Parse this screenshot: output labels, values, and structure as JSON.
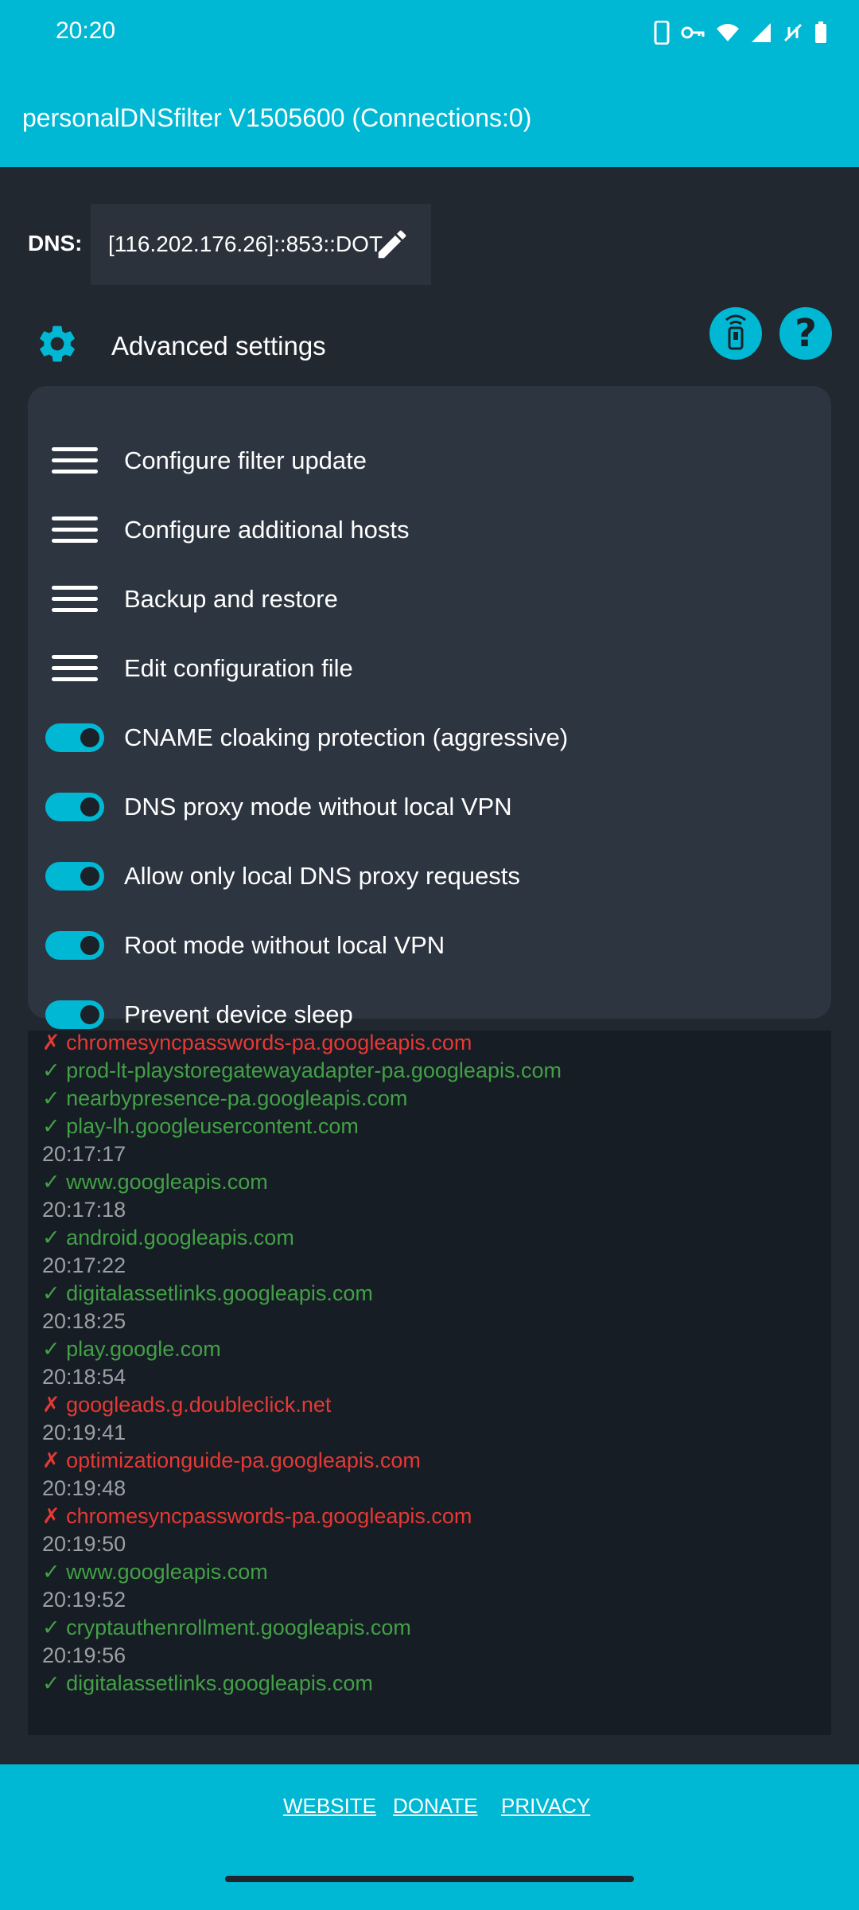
{
  "status_bar": {
    "time": "20:20"
  },
  "app": {
    "title": "personalDNSfilter V1505600 (Connections:0)"
  },
  "dns": {
    "label": "DNS:",
    "value": "[116.202.176.26]::853::DOT"
  },
  "advanced": {
    "label": "Advanced settings"
  },
  "menu_items": [
    {
      "label": "Configure filter update",
      "type": "menu"
    },
    {
      "label": "Configure additional hosts",
      "type": "menu"
    },
    {
      "label": "Backup and restore",
      "type": "menu"
    },
    {
      "label": "Edit configuration file",
      "type": "menu"
    },
    {
      "label": "CNAME cloaking protection (aggressive)",
      "type": "toggle",
      "on": true
    },
    {
      "label": "DNS proxy mode without local VPN",
      "type": "toggle",
      "on": true
    },
    {
      "label": "Allow only local DNS proxy requests",
      "type": "toggle",
      "on": true
    },
    {
      "label": "Root mode without local VPN",
      "type": "toggle",
      "on": true
    },
    {
      "label": "Prevent device sleep",
      "type": "toggle",
      "on": true
    }
  ],
  "log": [
    {
      "kind": "bad",
      "text": "✗ chromesyncpasswords-pa.googleapis.com"
    },
    {
      "kind": "ok",
      "text": "✓ prod-lt-playstoregatewayadapter-pa.googleapis.com"
    },
    {
      "kind": "ok",
      "text": "✓ nearbypresence-pa.googleapis.com"
    },
    {
      "kind": "ok",
      "text": "✓ play-lh.googleusercontent.com"
    },
    {
      "kind": "ts",
      "text": "20:17:17"
    },
    {
      "kind": "ok",
      "text": "✓ www.googleapis.com"
    },
    {
      "kind": "ts",
      "text": "20:17:18"
    },
    {
      "kind": "ok",
      "text": "✓ android.googleapis.com"
    },
    {
      "kind": "ts",
      "text": "20:17:22"
    },
    {
      "kind": "ok",
      "text": "✓ digitalassetlinks.googleapis.com"
    },
    {
      "kind": "ts",
      "text": "20:18:25"
    },
    {
      "kind": "ok",
      "text": "✓ play.google.com"
    },
    {
      "kind": "ts",
      "text": "20:18:54"
    },
    {
      "kind": "bad",
      "text": "✗ googleads.g.doubleclick.net"
    },
    {
      "kind": "ts",
      "text": "20:19:41"
    },
    {
      "kind": "bad",
      "text": "✗ optimizationguide-pa.googleapis.com"
    },
    {
      "kind": "ts",
      "text": "20:19:48"
    },
    {
      "kind": "bad",
      "text": "✗ chromesyncpasswords-pa.googleapis.com"
    },
    {
      "kind": "ts",
      "text": "20:19:50"
    },
    {
      "kind": "ok",
      "text": "✓ www.googleapis.com"
    },
    {
      "kind": "ts",
      "text": "20:19:52"
    },
    {
      "kind": "ok",
      "text": "✓ cryptauthenrollment.googleapis.com"
    },
    {
      "kind": "ts",
      "text": "20:19:56"
    },
    {
      "kind": "ok",
      "text": "✓ digitalassetlinks.googleapis.com"
    }
  ],
  "footer": {
    "website": "WEBSITE",
    "donate": "DONATE",
    "privacy": "PRIVACY"
  },
  "colors": {
    "accent": "#00b8d4",
    "ok": "#43a047",
    "bad": "#e53935",
    "background": "#212830"
  }
}
